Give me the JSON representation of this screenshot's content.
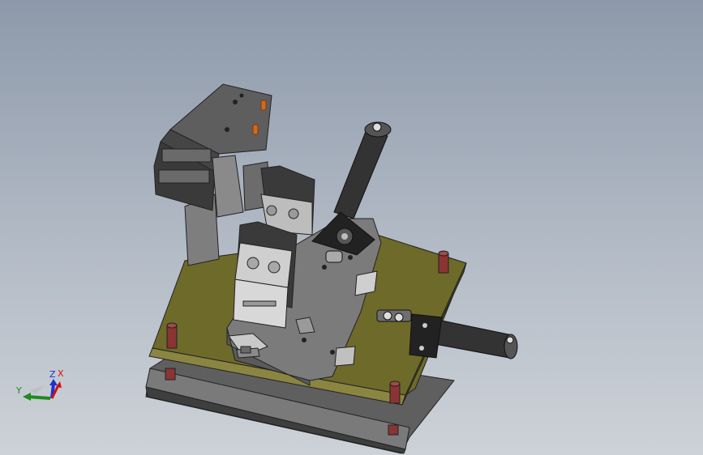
{
  "viewport": {
    "background_top": "#8d99aa",
    "background_bottom": "#cdd2d8"
  },
  "triad": {
    "x_label": "X",
    "y_label": "Y",
    "z_label": "Z",
    "x_color": "#d01010",
    "y_color": "#1f8a1f",
    "z_color": "#1f2fd0"
  },
  "model": {
    "base_plate_color": "#6e6e6e",
    "top_plate_color": "#6e6a2a",
    "pin_color": "#8a3434",
    "accent_color": "#d2691e"
  }
}
